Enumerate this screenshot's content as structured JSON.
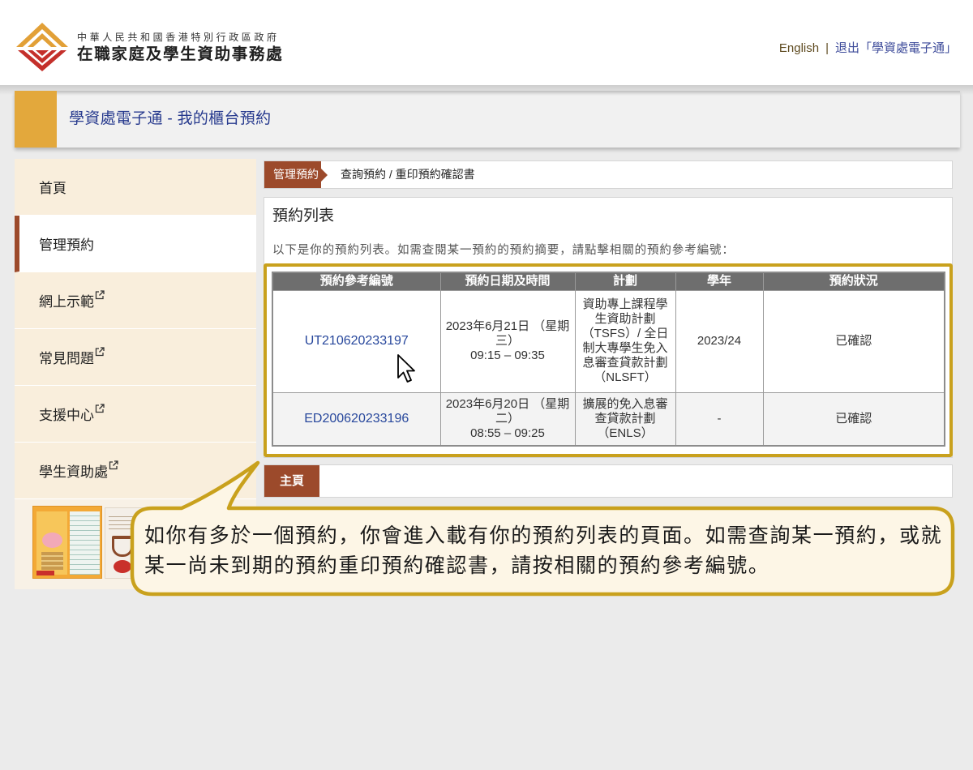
{
  "header": {
    "gov_name": "中華人民共和國香港特別行政區政府",
    "agency_name": "在職家庭及學生資助事務處",
    "language_link": "English",
    "separator": "|",
    "logout_link": "退出「學資處電子通」"
  },
  "title_bar": {
    "title": "學資處電子通 - 我的櫃台預約"
  },
  "sidebar": {
    "items": [
      {
        "label": "首頁",
        "active": false,
        "external": false
      },
      {
        "label": "管理預約",
        "active": true,
        "external": false
      },
      {
        "label": "網上示範",
        "active": false,
        "external": true
      },
      {
        "label": "常見問題",
        "active": false,
        "external": true
      },
      {
        "label": "支援中心",
        "active": false,
        "external": true
      },
      {
        "label": "學生資助處",
        "active": false,
        "external": true
      }
    ]
  },
  "breadcrumb": {
    "section": "管理預約",
    "page": "查詢預約 / 重印預約確認書"
  },
  "bookings": {
    "heading": "預約列表",
    "description": "以下是你的預約列表。如需查閱某一預約的預約摘要，請點擊相關的預約參考編號：",
    "columns": [
      "預約參考編號",
      "預約日期及時間",
      "計劃",
      "學年",
      "預約狀況"
    ],
    "rows": [
      {
        "reference": "UT210620233197",
        "date": "2023年6月21日 （星期三）",
        "time": "09:15 – 09:35",
        "scheme": "資助專上課程學生資助計劃（TSFS）/ 全日制大專學生免入息審查貸款計劃（NLSFT）",
        "academic_year": "2023/24",
        "status": "已確認"
      },
      {
        "reference": "ED200620233196",
        "date": "2023年6月20日 （星期二）",
        "time": "08:55 – 09:25",
        "scheme": "擴展的免入息審查貸款計劃（ENLS）",
        "academic_year": "-",
        "status": "已確認"
      }
    ]
  },
  "bottom_bar": {
    "home_tab": "主頁"
  },
  "callout": {
    "text": "如你有多於一個預約，你會進入載有你的預約列表的頁面。如需查詢某一預約，或就某一尚未到期的預約重印預約確認書，請按相關的預約參考編號。"
  },
  "colors": {
    "accent_gold": "#e3a83c",
    "nav_brown": "#9c4a2b",
    "title_blue": "#273a8e",
    "link_blue": "#27479c",
    "header_brown": "#5e4a1f",
    "logout_blue": "#3d4b9a",
    "highlight_gold": "#c9a11d"
  },
  "icons": [
    "agency-logo-icon",
    "external-link-icon",
    "mouse-cursor-icon"
  ]
}
